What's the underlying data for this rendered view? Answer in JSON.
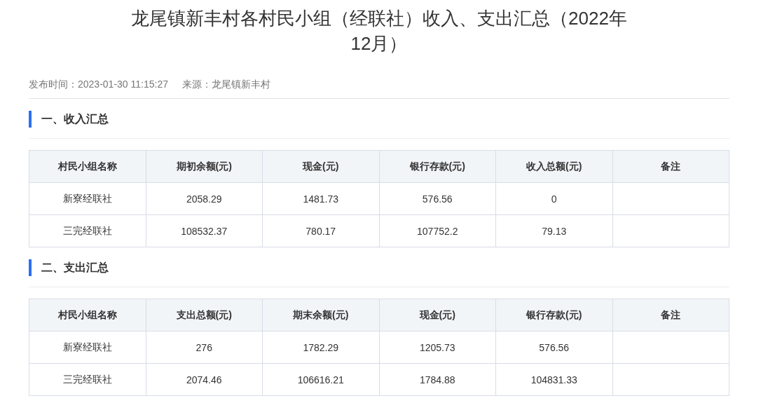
{
  "article": {
    "title": "龙尾镇新丰村各村民小组（经联社）收入、支出汇总（2022年12月）",
    "published": "发布时间：2023-01-30 11:15:27",
    "source": "来源：龙尾镇新丰村"
  },
  "sections": [
    {
      "heading": "一、收入汇总",
      "table": {
        "columns": [
          "村民小组名称",
          "期初余额(元)",
          "现金(元)",
          "银行存款(元)",
          "收入总额(元)",
          "备注"
        ],
        "rows": [
          [
            "新寮经联社",
            "2058.29",
            "1481.73",
            "576.56",
            "0"
          ],
          [
            "三完经联社",
            "108532.37",
            "780.17",
            "107752.2",
            "79.13"
          ]
        ]
      }
    },
    {
      "heading": "二、支出汇总",
      "table": {
        "columns": [
          "村民小组名称",
          "支出总额(元)",
          "期末余额(元)",
          "现金(元)",
          "银行存款(元)",
          "备注"
        ],
        "rows": [
          [
            "新寮经联社",
            "276",
            "1782.29",
            "1205.73",
            "576.56"
          ],
          [
            "三完经联社",
            "2074.46",
            "106616.21",
            "1784.88",
            "104831.33"
          ]
        ]
      }
    }
  ]
}
